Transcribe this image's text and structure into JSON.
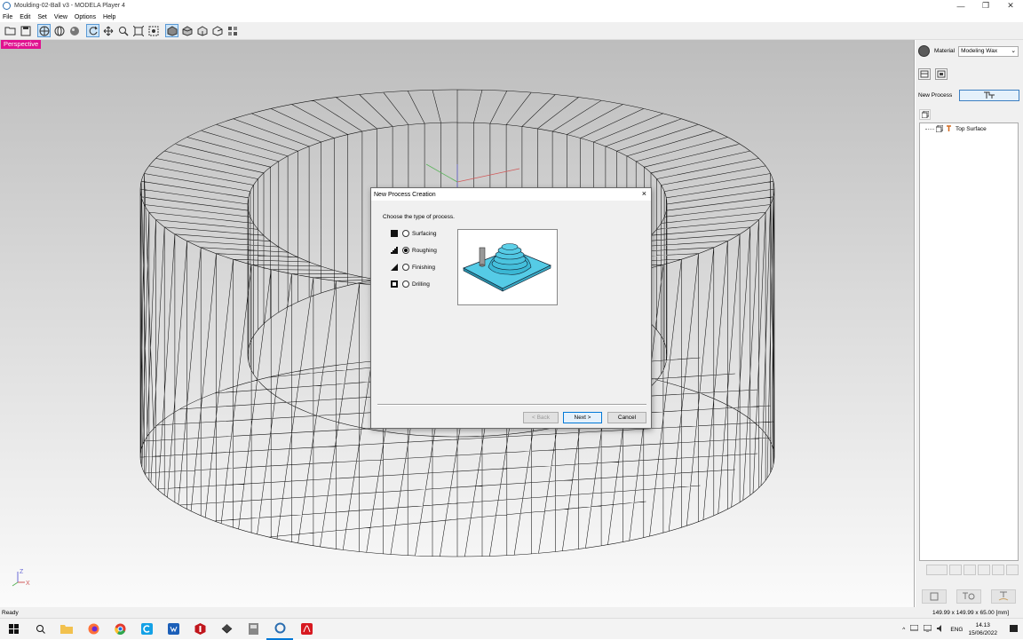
{
  "window": {
    "title": "Moulding-02-Ball v3 - MODELA Player 4"
  },
  "menu": [
    "File",
    "Edit",
    "Set",
    "View",
    "Options",
    "Help"
  ],
  "viewport": {
    "view_label": "Perspective",
    "axis": {
      "z": "Z",
      "x": "X"
    }
  },
  "panel": {
    "material_label": "Material",
    "material_value": "Modeling Wax",
    "new_process_label": "New Process",
    "tree": [
      {
        "label": "Top Surface"
      }
    ]
  },
  "dialog": {
    "title": "New Process Creation",
    "prompt": "Choose the type of process.",
    "options": [
      {
        "label": "Surfacing",
        "selected": false
      },
      {
        "label": "Roughing",
        "selected": true
      },
      {
        "label": "Finishing",
        "selected": false
      },
      {
        "label": "Drilling",
        "selected": false
      }
    ],
    "buttons": {
      "back": "< Back",
      "next": "Next >",
      "cancel": "Cancel"
    },
    "close": "×"
  },
  "status": {
    "text": "Ready",
    "dimensions": "149.99 x 149.99 x 65.00 [mm]"
  },
  "taskbar": {
    "lang": "ENG",
    "time": "14.13",
    "date": "15/06/2022"
  },
  "colors": {
    "accent": "#e0118f",
    "preview_cyan": "#55cbe6",
    "focus": "#3c7fc1"
  }
}
